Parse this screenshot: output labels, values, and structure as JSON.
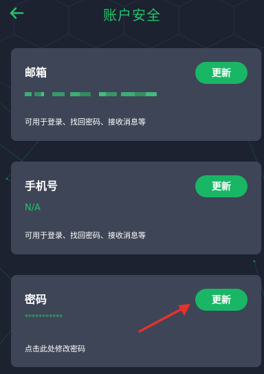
{
  "header": {
    "title": "账户安全",
    "back_icon": "arrow-left-icon"
  },
  "colors": {
    "background": "#1c2230",
    "card": "#3e4556",
    "accent": "#19b765",
    "title_green": "#22c46a",
    "arrow": "#e5332a"
  },
  "cards": [
    {
      "title": "邮箱",
      "button_label": "更新",
      "value": "",
      "description": "可用于登录、找回密码、接收消息等"
    },
    {
      "title": "手机号",
      "button_label": "更新",
      "value": "N/A",
      "description": "可用于登录、找回密码、接收消息等"
    },
    {
      "title": "密码",
      "button_label": "更新",
      "value": "***********",
      "description": "点击此处修改密码"
    }
  ]
}
